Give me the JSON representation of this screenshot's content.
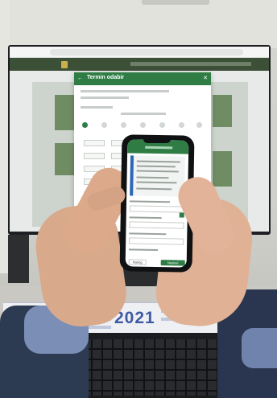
{
  "scene": {
    "subject": "phone-in-hands-over-desktop-monitor"
  },
  "monitor_modal": {
    "title": "Termin odabir",
    "back_icon": "arrow-left-icon",
    "close_icon": "close-icon"
  },
  "phone_app": {
    "primary_button": "Nastavi",
    "secondary_button": "Natrag"
  },
  "desk": {
    "calendar_year": "2021"
  },
  "colors": {
    "accent_green": "#2f7d45",
    "accent_blue": "#2e68b4"
  }
}
